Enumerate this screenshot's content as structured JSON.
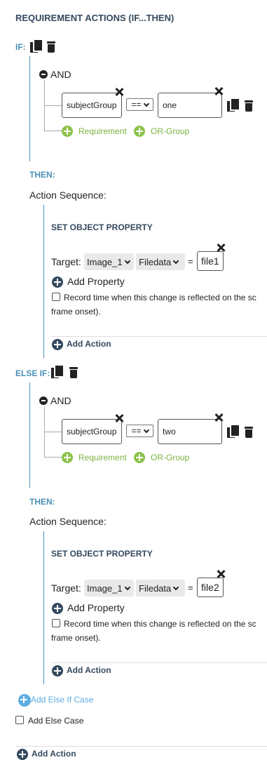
{
  "title": "REQUIREMENT ACTIONS (IF...THEN)",
  "if_label": "IF:",
  "else_if_label": "ELSE IF:",
  "and_label": "AND",
  "then_label": "THEN:",
  "action_sequence_label": "Action Sequence:",
  "requirement_link": "Requirement",
  "or_group_link": "OR-Group",
  "set_object_property_title": "SET OBJECT PROPERTY",
  "target_label": "Target:",
  "equals_sign": "=",
  "add_property_label": "Add Property",
  "record_time_text_line1": "Record time when this change is reflected on the sc",
  "record_time_text_line2": "frame onset).",
  "add_action_label": "Add Action",
  "add_else_if_case_label": "Add Else If Case",
  "add_else_case_label": "Add Else Case",
  "bottom_add_action_label": "Add Action",
  "blocks": [
    {
      "condition": {
        "variable": "subjectGroup",
        "operator": "==",
        "value": "one"
      },
      "action": {
        "object": "Image_1",
        "property": "Filedata",
        "value": "file1"
      }
    },
    {
      "condition": {
        "variable": "subjectGroup",
        "operator": "==",
        "value": "two"
      },
      "action": {
        "object": "Image_1",
        "property": "Filedata",
        "value": "file2"
      }
    }
  ],
  "colors": {
    "heading": "#34495e",
    "accent_blue": "#4a90b8",
    "green": "#8bc34a",
    "light_blue": "#5dade2"
  }
}
